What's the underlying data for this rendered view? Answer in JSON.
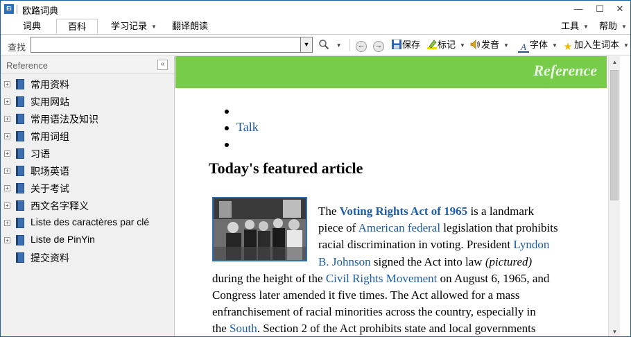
{
  "window": {
    "title": "欧路词典",
    "app_icon_text": "Ei",
    "minimize": "—",
    "maximize": "☐",
    "close": "✕"
  },
  "tabs": [
    {
      "label": "词典",
      "active": false
    },
    {
      "label": "百科",
      "active": true
    },
    {
      "label": "学习记录",
      "dropdown": true
    },
    {
      "label": "翻译朗读"
    }
  ],
  "menus": {
    "tools": "工具",
    "help": "帮助"
  },
  "toolbar": {
    "search_label": "查找",
    "search_value": "",
    "save": "保存",
    "mark": "标记",
    "speak": "发音",
    "font": "字体",
    "add_wordbook": "加入生词本",
    "icons": {
      "search": "search-icon",
      "back": "back-arrow-icon",
      "forward": "forward-arrow-icon",
      "save": "floppy-disk-icon",
      "mark": "highlighter-icon",
      "speak": "speaker-icon",
      "font": "font-icon",
      "add_wordbook": "star-icon"
    }
  },
  "sidebar": {
    "title": "Reference",
    "items": [
      {
        "label": "常用资料",
        "expandable": true
      },
      {
        "label": "实用网站",
        "expandable": true
      },
      {
        "label": "常用语法及知识",
        "expandable": true
      },
      {
        "label": "常用词组",
        "expandable": true
      },
      {
        "label": "习语",
        "expandable": true
      },
      {
        "label": "职场英语",
        "expandable": true
      },
      {
        "label": "关于考试",
        "expandable": true
      },
      {
        "label": "西文名字释义",
        "expandable": true
      },
      {
        "label": "Liste des caractères par clé",
        "expandable": true
      },
      {
        "label": "Liste de PinYin",
        "expandable": true
      },
      {
        "label": "提交资料",
        "expandable": false
      }
    ]
  },
  "content": {
    "banner": "Reference",
    "bullets": [
      "",
      "Talk",
      ""
    ],
    "heading": "Today's featured article",
    "article": {
      "l1_a": "The ",
      "l1_link": "Voting Rights Act of 1965",
      "l1_b": " is a landmark",
      "l2_a": "piece of ",
      "l2_link": "American federal",
      "l2_b": " legislation that prohibits",
      "l3_a": "racial discrimination in voting. President ",
      "l3_link": "Lyndon",
      "l4_link": "B. Johnson",
      "l4_a": " signed the Act into law ",
      "l4_em": "(pictured)",
      "l5_a": "during the height of the ",
      "l5_link": "Civil Rights Movement",
      "l5_b": " on August 6, 1965, and",
      "l6": "Congress later amended it five times. The Act allowed for a mass",
      "l7": "enfranchisement of racial minorities across the country, especially in",
      "l8_a": "the ",
      "l8_link": "South",
      "l8_b": ". Section 2 of the Act prohibits state and local governments"
    }
  },
  "colors": {
    "banner_green": "#77cc4a",
    "link_blue": "#1d5da5",
    "sidebar_bg": "#f0f0f0"
  }
}
